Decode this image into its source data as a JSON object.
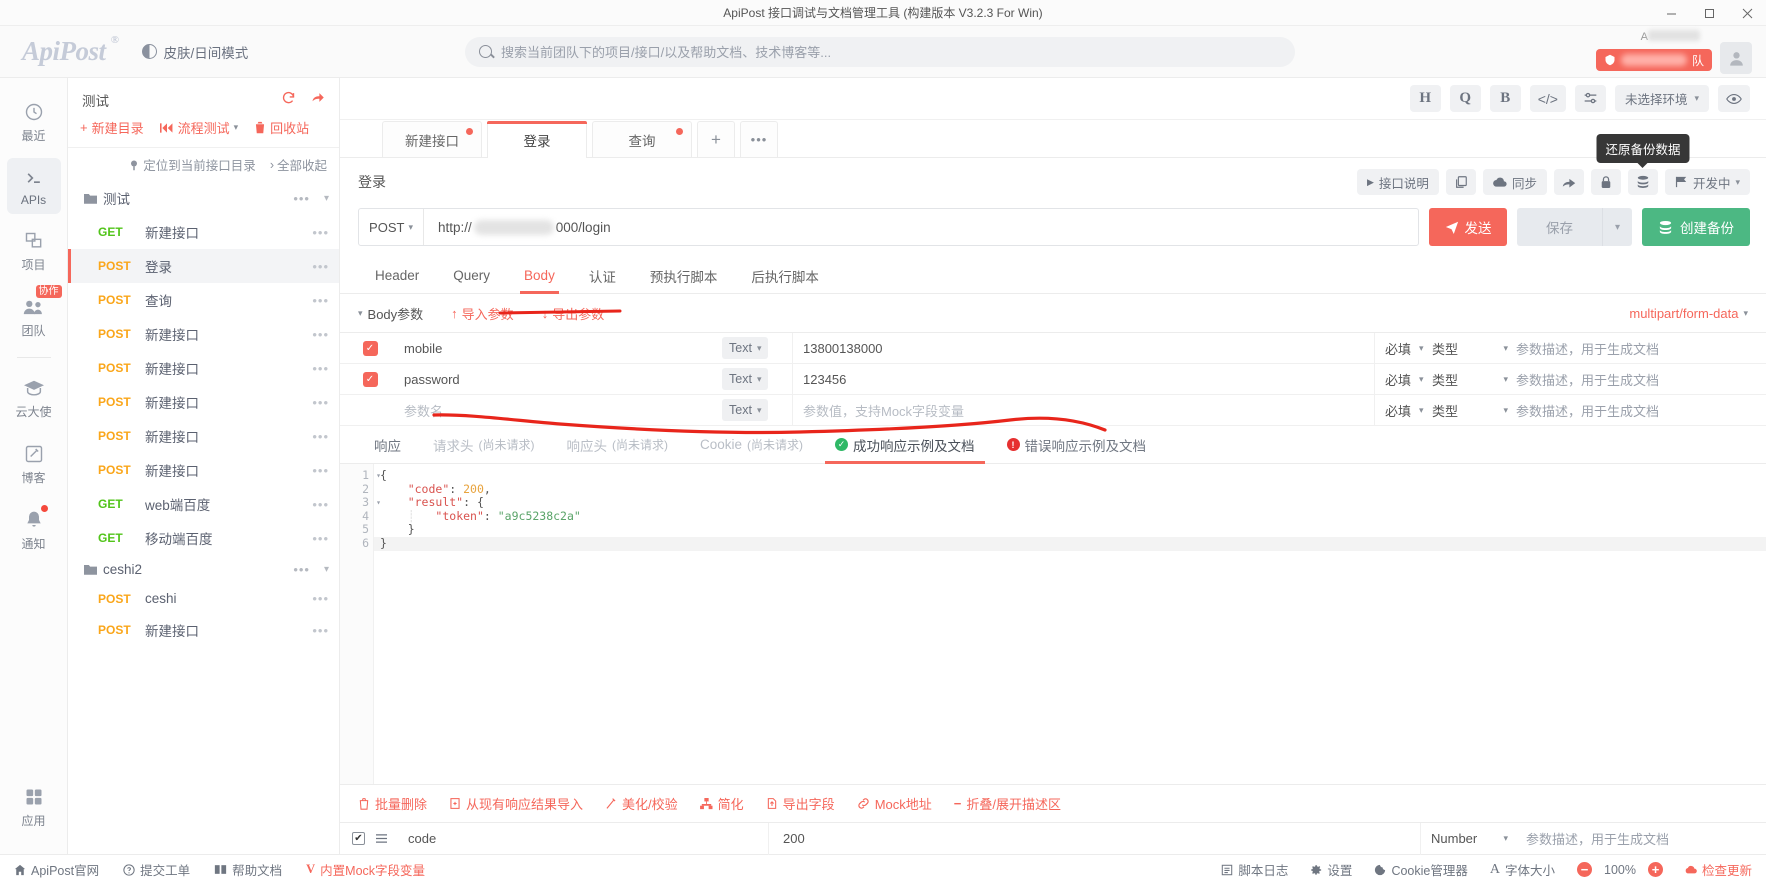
{
  "window": {
    "title": "ApiPost 接口调试与文档管理工具 (构建版本 V3.2.3 For Win)",
    "minimize": "–",
    "maximize": "▢",
    "close": "✕"
  },
  "header": {
    "logo": "ApiPost",
    "logo_reg": "®",
    "skin_toggle": "皮肤/日间模式",
    "search_placeholder": "搜索当前团队下的项目/接口/以及帮助文档、技术博客等...",
    "user_suffix": "队"
  },
  "rail": {
    "items": [
      {
        "label": "最近",
        "icon": "clock-icon",
        "active": false,
        "badge": "",
        "dot": false
      },
      {
        "label": "APIs",
        "icon": "terminal-icon",
        "active": true,
        "badge": "",
        "dot": false
      },
      {
        "label": "项目",
        "icon": "project-icon",
        "active": false,
        "badge": "",
        "dot": false
      },
      {
        "label": "团队",
        "icon": "team-icon",
        "active": false,
        "badge": "协作",
        "dot": false
      },
      {
        "label": "云大使",
        "icon": "graduation-icon",
        "active": false,
        "badge": "",
        "dot": false
      },
      {
        "label": "博客",
        "icon": "pencil-square-icon",
        "active": false,
        "badge": "",
        "dot": false
      },
      {
        "label": "通知",
        "icon": "bell-icon",
        "active": false,
        "badge": "",
        "dot": true
      }
    ],
    "bottom": {
      "label": "应用",
      "icon": "grid-icon"
    }
  },
  "tree": {
    "project_name": "测试",
    "head_actions": [
      "refresh-icon",
      "share-icon"
    ],
    "tools": [
      {
        "label": "新建目录",
        "icon": "plus-icon"
      },
      {
        "label": "流程测试",
        "icon": "flow-icon",
        "caret": true
      },
      {
        "label": "回收站",
        "icon": "trash-icon"
      }
    ],
    "locate": "定位到当前接口目录",
    "collapse": "全部收起",
    "nodes": [
      {
        "type": "folder",
        "label": "测试",
        "expanded": true
      },
      {
        "type": "api",
        "method": "GET",
        "label": "新建接口",
        "selected": false
      },
      {
        "type": "api",
        "method": "POST",
        "label": "登录",
        "selected": true
      },
      {
        "type": "api",
        "method": "POST",
        "label": "查询",
        "selected": false
      },
      {
        "type": "api",
        "method": "POST",
        "label": "新建接口",
        "selected": false
      },
      {
        "type": "api",
        "method": "POST",
        "label": "新建接口",
        "selected": false
      },
      {
        "type": "api",
        "method": "POST",
        "label": "新建接口",
        "selected": false
      },
      {
        "type": "api",
        "method": "POST",
        "label": "新建接口",
        "selected": false
      },
      {
        "type": "api",
        "method": "POST",
        "label": "新建接口",
        "selected": false
      },
      {
        "type": "api",
        "method": "GET",
        "label": "web端百度",
        "selected": false
      },
      {
        "type": "api",
        "method": "GET",
        "label": "移动端百度",
        "selected": false
      },
      {
        "type": "folder",
        "label": "ceshi2",
        "expanded": true
      },
      {
        "type": "api",
        "method": "POST",
        "label": "ceshi",
        "selected": false
      },
      {
        "type": "api",
        "method": "POST",
        "label": "新建接口",
        "selected": false
      }
    ]
  },
  "toptools": {
    "buttons": [
      "H",
      "Q",
      "B",
      "</>",
      "sliders-icon"
    ],
    "env_label": "未选择环境",
    "eye": "eye-icon"
  },
  "tabs": {
    "items": [
      {
        "label": "新建接口",
        "active": false,
        "dirty": true
      },
      {
        "label": "登录",
        "active": true,
        "dirty": false
      },
      {
        "label": "查询",
        "active": false,
        "dirty": true
      }
    ],
    "add": "+",
    "more": "•••"
  },
  "apihead": {
    "title": "登录",
    "desc_btn": "接口说明",
    "copy_icon": "copy-icon",
    "sync_btn": "同步",
    "share_icon": "share-icon",
    "lock_icon": "lock-icon",
    "backup_icon": "database-icon",
    "status_btn": "开发中",
    "tooltip": "还原备份数据"
  },
  "url": {
    "method": "POST",
    "prefix": "http://",
    "suffix": "000/login",
    "send": "发送",
    "save": "保存",
    "create_backup": "创建备份"
  },
  "reqtabs": [
    {
      "label": "Header",
      "active": false
    },
    {
      "label": "Query",
      "active": false
    },
    {
      "label": "Body",
      "active": true
    },
    {
      "label": "认证",
      "active": false
    },
    {
      "label": "预执行脚本",
      "active": false
    },
    {
      "label": "后执行脚本",
      "active": false
    }
  ],
  "bodyparams": {
    "title": "Body参数",
    "import": "导入参数",
    "export": "导出参数",
    "content_type": "multipart/form-data",
    "required_label": "必填",
    "type_label": "类型",
    "desc_placeholder": "参数描述，用于生成文档",
    "rows": [
      {
        "checked": true,
        "name": "mobile",
        "type": "Text",
        "value": "13800138000",
        "required": "必填",
        "vtype": "类型",
        "desc": "参数描述，用于生成文档"
      },
      {
        "checked": true,
        "name": "password",
        "type": "Text",
        "value": "123456",
        "required": "必填",
        "vtype": "类型",
        "desc": "参数描述，用于生成文档"
      },
      {
        "checked": false,
        "name": "参数名",
        "type": "Text",
        "value": "参数值，支持Mock字段变量",
        "required": "必填",
        "vtype": "类型",
        "desc": "参数描述，用于生成文档",
        "placeholder": true
      }
    ]
  },
  "resptabs": [
    {
      "label": "响应",
      "note": "",
      "active": false,
      "dim": false,
      "icon": ""
    },
    {
      "label": "请求头",
      "note": "(尚未请求)",
      "active": false,
      "dim": true,
      "icon": ""
    },
    {
      "label": "响应头",
      "note": "(尚未请求)",
      "active": false,
      "dim": true,
      "icon": ""
    },
    {
      "label": "Cookie",
      "note": "(尚未请求)",
      "active": false,
      "dim": true,
      "icon": ""
    },
    {
      "label": "成功响应示例及文档",
      "note": "",
      "active": true,
      "dim": false,
      "icon": "check-circle-icon"
    },
    {
      "label": "错误响应示例及文档",
      "note": "",
      "active": false,
      "dim": false,
      "icon": "error-circle-icon"
    }
  ],
  "editor": {
    "lines": [
      {
        "n": "1",
        "fold": true,
        "text": "{"
      },
      {
        "n": "2",
        "fold": false,
        "text": "    \"code\": 200,"
      },
      {
        "n": "3",
        "fold": true,
        "text": "    \"result\": {"
      },
      {
        "n": "4",
        "fold": false,
        "text": "        \"token\": \"a9c5238c2a\""
      },
      {
        "n": "5",
        "fold": false,
        "text": "    }"
      },
      {
        "n": "6",
        "fold": false,
        "text": "}"
      }
    ],
    "tools": [
      {
        "label": "批量删除",
        "icon": "trash-icon"
      },
      {
        "label": "从现有响应结果导入",
        "icon": "import-icon"
      },
      {
        "label": "美化/校验",
        "icon": "wand-icon"
      },
      {
        "label": "简化",
        "icon": "tree-icon"
      },
      {
        "label": "导出字段",
        "icon": "export-icon"
      },
      {
        "label": "Mock地址",
        "icon": "link-icon"
      },
      {
        "label": "折叠/展开描述区",
        "icon": "minus-icon"
      }
    ],
    "field_row": {
      "checked": true,
      "name": "code",
      "value": "200",
      "type": "Number",
      "desc": "参数描述，用于生成文档"
    }
  },
  "status": {
    "left": [
      {
        "label": "ApiPost官网",
        "icon": "home-icon",
        "red": false
      },
      {
        "label": "提交工单",
        "icon": "question-icon",
        "red": false
      },
      {
        "label": "帮助文档",
        "icon": "book-icon",
        "red": false
      },
      {
        "label": "内置Mock字段变量",
        "icon": "v-icon",
        "red": true
      }
    ],
    "right": [
      {
        "label": "脚本日志",
        "icon": "log-icon",
        "red": false
      },
      {
        "label": "设置",
        "icon": "gear-icon",
        "red": false
      },
      {
        "label": "Cookie管理器",
        "icon": "cookie-icon",
        "red": false
      },
      {
        "label": "字体大小",
        "icon": "font-icon",
        "red": false
      }
    ],
    "zoom_minus": "−",
    "zoom_value": "100%",
    "zoom_plus": "+",
    "update": "检查更新"
  },
  "colors": {
    "accent": "#f5675b",
    "green": "#4cb883",
    "get": "#52c41a",
    "post": "#faa61a"
  }
}
